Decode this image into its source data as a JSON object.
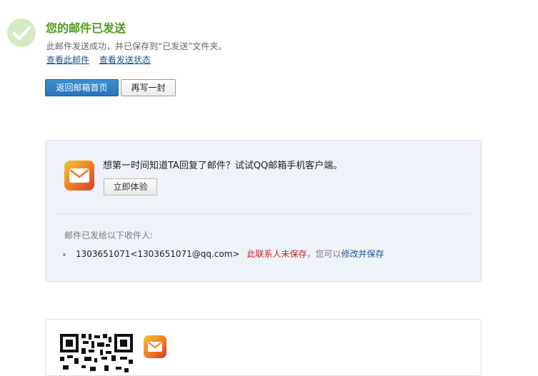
{
  "header": {
    "icon": "checkmark-icon",
    "title": "您的邮件已发送",
    "subtitle": "此邮件发送成功，并已保存到“已发送”文件夹。",
    "links": {
      "view_mail": "查看此邮件",
      "view_status": "查看发送状态"
    }
  },
  "actions": {
    "back_home": "返回邮箱首页",
    "write_another": "再写一封"
  },
  "promo": {
    "icon": "qq-mail-app-icon",
    "text": "想第一时间知道TA回复了邮件？试试QQ邮箱手机客户端。",
    "try_button": "立即体验"
  },
  "recipients": {
    "label": "邮件已发给以下收件人:",
    "items": [
      {
        "address": "1303651071<1303651071@qq.com>",
        "status": "此联系人未保存",
        "hint": "，您可以",
        "action": "修改并保存"
      }
    ]
  },
  "bottom": {
    "qr_icon": "qr-code-icon",
    "app_icon": "qq-mail-app-icon"
  },
  "colors": {
    "title_green": "#4f9a1f",
    "link_blue": "#1e5494",
    "primary_button": "#2a73b9",
    "warning_red": "#c2262a",
    "panel_bg": "#eef3fa"
  }
}
